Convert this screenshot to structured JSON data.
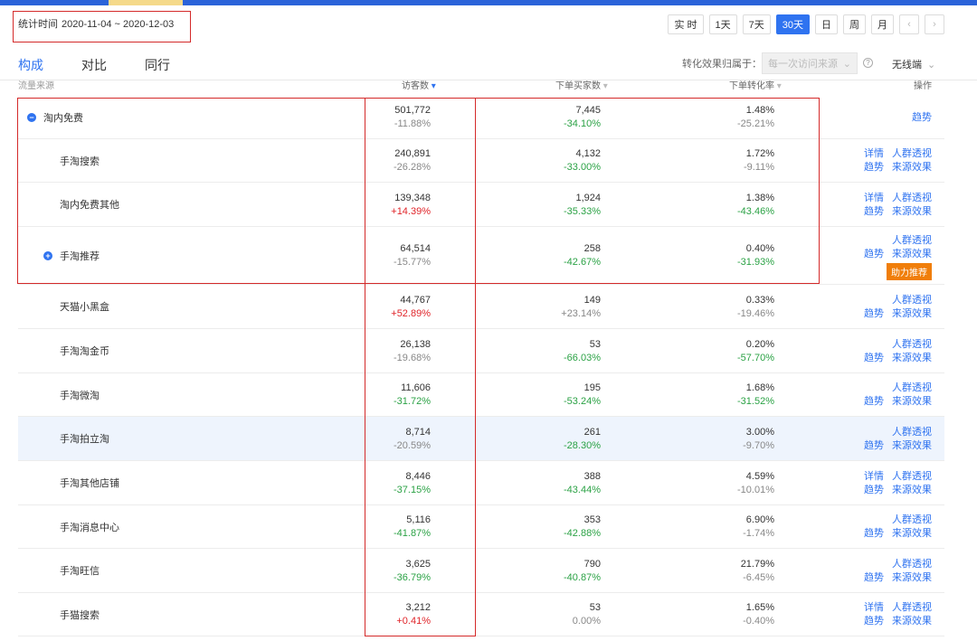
{
  "header": {
    "time_label": "统计时间",
    "date_range": "2020-11-04 ~ 2020-12-03",
    "periods": [
      "实 时",
      "1天",
      "7天",
      "30天",
      "日",
      "周",
      "月"
    ],
    "active_period": "30天",
    "prev": "‹",
    "next": "›"
  },
  "tabs": [
    "构成",
    "对比",
    "同行"
  ],
  "active_tab": "构成",
  "filter": {
    "attr_label": "转化效果归属于：",
    "attr_value": "每一次访问来源",
    "device": "无线端"
  },
  "columns": {
    "source": "流量来源",
    "visitors": "访客数",
    "buyers": "下单买家数",
    "conversion": "下单转化率",
    "ops": "操作"
  },
  "rows": [
    {
      "name": "淘内免费",
      "visitors": "501,772",
      "vchg": "-11.88%",
      "buyers": "7,445",
      "bchg": "-34.10%",
      "conv": "1.48%",
      "cchg": "-25.21%",
      "ops": [
        [
          "趋势"
        ]
      ],
      "level": 0,
      "expand": "−"
    },
    {
      "name": "手淘搜索",
      "visitors": "240,891",
      "vchg": "-26.28%",
      "buyers": "4,132",
      "bchg": "-33.00%",
      "conv": "1.72%",
      "cchg": "-9.11%",
      "ops": [
        [
          "详情",
          "人群透视"
        ],
        [
          "趋势",
          "来源效果"
        ]
      ],
      "level": 1
    },
    {
      "name": "淘内免费其他",
      "visitors": "139,348",
      "vchg": "+14.39%",
      "buyers": "1,924",
      "bchg": "-35.33%",
      "conv": "1.38%",
      "cchg": "-43.46%",
      "ops": [
        [
          "详情",
          "人群透视"
        ],
        [
          "趋势",
          "来源效果"
        ]
      ],
      "level": 1
    },
    {
      "name": "手淘推荐",
      "visitors": "64,514",
      "vchg": "-15.77%",
      "buyers": "258",
      "bchg": "-42.67%",
      "conv": "0.40%",
      "cchg": "-31.93%",
      "ops": [
        [
          "人群透视"
        ],
        [
          "趋势",
          "来源效果"
        ]
      ],
      "level": 1,
      "expand": "+",
      "badge": "助力推荐"
    },
    {
      "name": "天猫小黑盒",
      "visitors": "44,767",
      "vchg": "+52.89%",
      "buyers": "149",
      "bchg": "+23.14%",
      "conv": "0.33%",
      "cchg": "-19.46%",
      "ops": [
        [
          "人群透视"
        ],
        [
          "趋势",
          "来源效果"
        ]
      ],
      "level": 1
    },
    {
      "name": "手淘淘金币",
      "visitors": "26,138",
      "vchg": "-19.68%",
      "buyers": "53",
      "bchg": "-66.03%",
      "conv": "0.20%",
      "cchg": "-57.70%",
      "ops": [
        [
          "人群透视"
        ],
        [
          "趋势",
          "来源效果"
        ]
      ],
      "level": 1
    },
    {
      "name": "手淘微淘",
      "visitors": "11,606",
      "vchg": "-31.72%",
      "buyers": "195",
      "bchg": "-53.24%",
      "conv": "1.68%",
      "cchg": "-31.52%",
      "ops": [
        [
          "人群透视"
        ],
        [
          "趋势",
          "来源效果"
        ]
      ],
      "level": 1
    },
    {
      "name": "手淘拍立淘",
      "visitors": "8,714",
      "vchg": "-20.59%",
      "buyers": "261",
      "bchg": "-28.30%",
      "conv": "3.00%",
      "cchg": "-9.70%",
      "ops": [
        [
          "人群透视"
        ],
        [
          "趋势",
          "来源效果"
        ]
      ],
      "level": 1,
      "highlight": true
    },
    {
      "name": "手淘其他店铺",
      "visitors": "8,446",
      "vchg": "-37.15%",
      "buyers": "388",
      "bchg": "-43.44%",
      "conv": "4.59%",
      "cchg": "-10.01%",
      "ops": [
        [
          "详情",
          "人群透视"
        ],
        [
          "趋势",
          "来源效果"
        ]
      ],
      "level": 1
    },
    {
      "name": "手淘消息中心",
      "visitors": "5,116",
      "vchg": "-41.87%",
      "buyers": "353",
      "bchg": "-42.88%",
      "conv": "6.90%",
      "cchg": "-1.74%",
      "ops": [
        [
          "人群透视"
        ],
        [
          "趋势",
          "来源效果"
        ]
      ],
      "level": 1
    },
    {
      "name": "手淘旺信",
      "visitors": "3,625",
      "vchg": "-36.79%",
      "buyers": "790",
      "bchg": "-40.87%",
      "conv": "21.79%",
      "cchg": "-6.45%",
      "ops": [
        [
          "人群透视"
        ],
        [
          "趋势",
          "来源效果"
        ]
      ],
      "level": 1
    },
    {
      "name": "手猫搜索",
      "visitors": "3,212",
      "vchg": "+0.41%",
      "buyers": "53",
      "bchg": "0.00%",
      "conv": "1.65%",
      "cchg": "-0.40%",
      "ops": [
        [
          "详情",
          "人群透视"
        ],
        [
          "趋势",
          "来源效果"
        ]
      ],
      "level": 1
    }
  ]
}
